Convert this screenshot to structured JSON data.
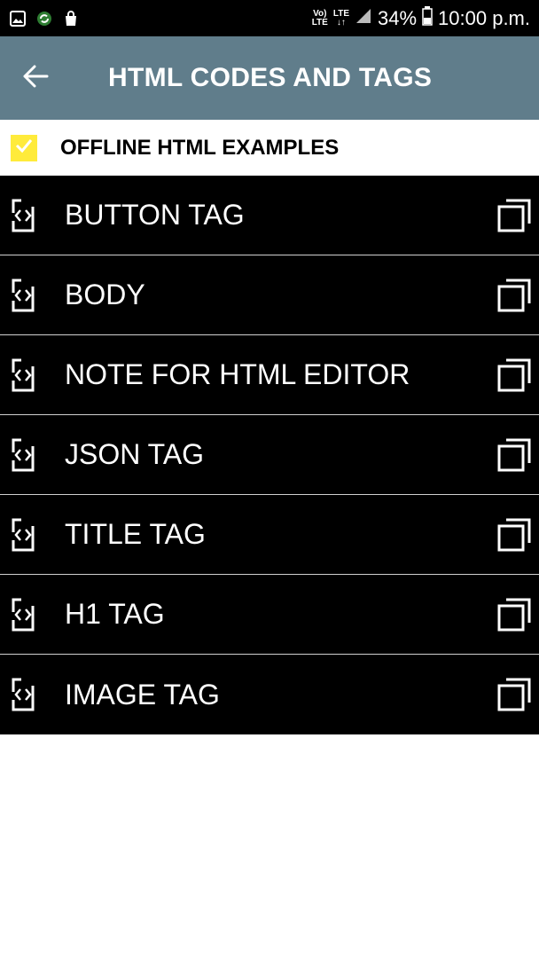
{
  "status_bar": {
    "network_label_top": "Vo)",
    "network_label_bottom": "LTE",
    "lte_label": "LTE",
    "battery": "34%",
    "time": "10:00 p.m."
  },
  "app_bar": {
    "title": "HTML CODES AND TAGS"
  },
  "section": {
    "label": "OFFLINE HTML EXAMPLES",
    "checked": true
  },
  "items": [
    {
      "label": "BUTTON TAG"
    },
    {
      "label": "BODY"
    },
    {
      "label": "NOTE FOR HTML EDITOR"
    },
    {
      "label": "JSON TAG"
    },
    {
      "label": "TITLE TAG"
    },
    {
      "label": "H1 TAG"
    },
    {
      "label": "IMAGE TAG"
    }
  ],
  "colors": {
    "app_bar": "#607d8b",
    "checkbox": "#ffeb3b",
    "list_bg": "#000000"
  }
}
